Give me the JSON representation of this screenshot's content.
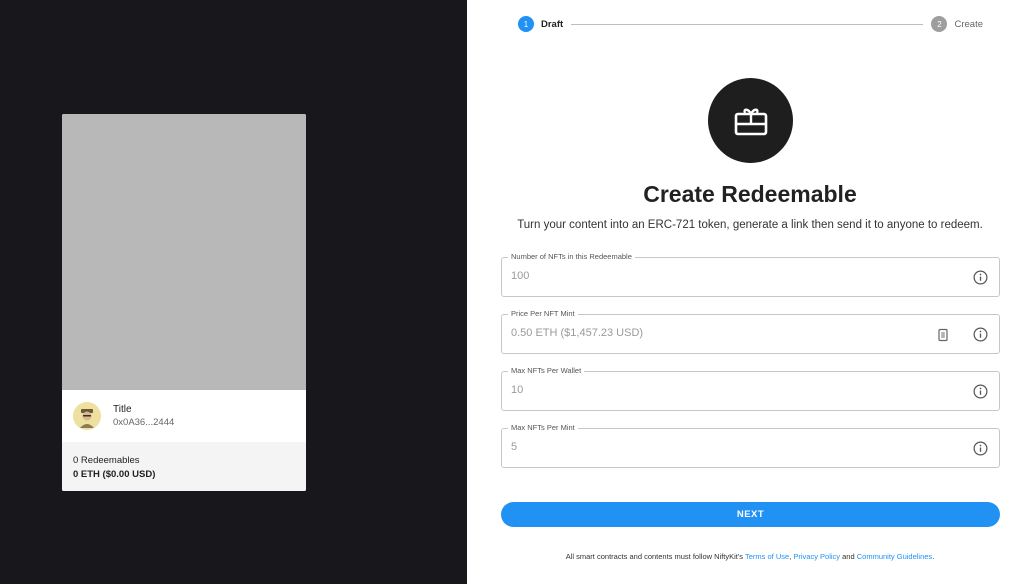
{
  "preview": {
    "title": "Title",
    "address": "0x0A36...2444",
    "redeemables": "0 Redeemables",
    "price": "0 ETH ($0.00 USD)"
  },
  "stepper": {
    "steps": [
      {
        "number": "1",
        "label": "Draft"
      },
      {
        "number": "2",
        "label": "Create"
      }
    ]
  },
  "hero": {
    "title": "Create Redeemable",
    "subtitle": "Turn your content into an ERC-721 token, generate a link then send it to anyone to redeem."
  },
  "fields": [
    {
      "label": "Number of NFTs in this Redeemable",
      "placeholder": "100"
    },
    {
      "label": "Price Per NFT Mint",
      "placeholder": "0.50 ETH ($1,457.23 USD)"
    },
    {
      "label": "Max NFTs Per Wallet",
      "placeholder": "10"
    },
    {
      "label": "Max NFTs Per Mint",
      "placeholder": "5"
    }
  ],
  "next_label": "NEXT",
  "legal": {
    "prefix": "All smart contracts and contents must follow NiftyKit's ",
    "terms": "Terms of Use",
    "sep1": ", ",
    "privacy": "Privacy Policy",
    "sep2": " and ",
    "guidelines": "Community Guidelines",
    "suffix": "."
  },
  "icons": {
    "hero": "gift-card-icon",
    "info": "info-icon",
    "currency": "currency-icon"
  },
  "colors": {
    "accent": "#2191f3",
    "dark_pane": "#18171c"
  }
}
